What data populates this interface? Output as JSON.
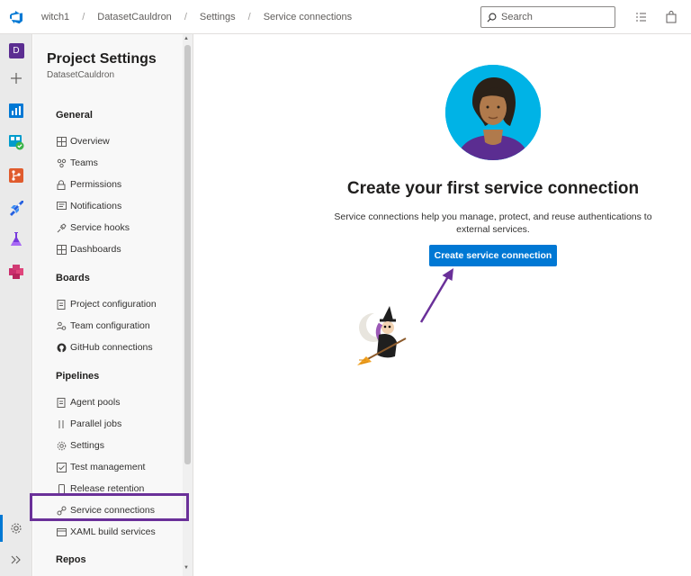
{
  "topbar": {
    "breadcrumb": [
      "witch1",
      "DatasetCauldron",
      "Settings",
      "Service connections"
    ],
    "search_placeholder": "Search"
  },
  "rail": {
    "project_initial": "D",
    "icons": [
      "overview-icon",
      "add-icon",
      "boards-icon",
      "test-plans-icon",
      "repos-icon",
      "pipelines-icon",
      "test-icon",
      "artifacts-icon",
      "settings-icon",
      "expand-icon"
    ]
  },
  "nav": {
    "title": "Project Settings",
    "subtitle": "DatasetCauldron",
    "sections": [
      {
        "heading": "General",
        "items": [
          "Overview",
          "Teams",
          "Permissions",
          "Notifications",
          "Service hooks",
          "Dashboards"
        ]
      },
      {
        "heading": "Boards",
        "items": [
          "Project configuration",
          "Team configuration",
          "GitHub connections"
        ]
      },
      {
        "heading": "Pipelines",
        "items": [
          "Agent pools",
          "Parallel jobs",
          "Settings",
          "Test management",
          "Release retention",
          "Service connections",
          "XAML build services"
        ]
      },
      {
        "heading": "Repos",
        "items": []
      }
    ],
    "active_item": "Service connections"
  },
  "main": {
    "title": "Create your first service connection",
    "description": "Service connections help you manage, protect, and reuse authentications to external services.",
    "cta_label": "Create service connection"
  },
  "colors": {
    "accent": "#0078d4",
    "highlight": "#6a3099",
    "avatar_bg": "#00b3e6"
  }
}
